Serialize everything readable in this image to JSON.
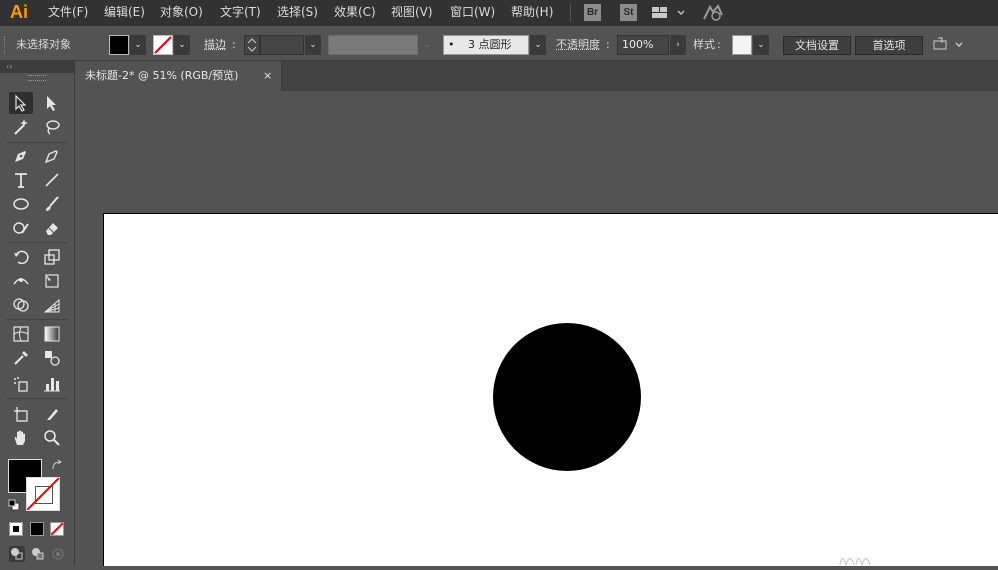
{
  "app": {
    "logo": "Ai"
  },
  "menu": [
    "文件(F)",
    "编辑(E)",
    "对象(O)",
    "文字(T)",
    "选择(S)",
    "效果(C)",
    "视图(V)",
    "窗口(W)",
    "帮助(H)"
  ],
  "menubar_icons": {
    "bridge": "Br",
    "stock": "St"
  },
  "control_bar": {
    "selection_status": "未选择对象",
    "stroke_label": "描边",
    "stroke_colon": ":",
    "brush_value": "3 点圆形",
    "brush_dot": "•",
    "opacity_label": "不透明度",
    "opacity_colon": ":",
    "opacity_value": "100%",
    "style_label": "样式",
    "style_colon": ":",
    "doc_setup": "文档设置",
    "preferences": "首选项",
    "dropdown_glyph": "⌄",
    "arrow_glyph": "›"
  },
  "tools_panel": {
    "collapse_glyph": "‹‹"
  },
  "document_tab": {
    "title": "未标题-2* @ 51% (RGB/预览)",
    "close": "×"
  },
  "colors": {
    "fill": "#000000",
    "stroke": "none",
    "accent": "#ff9a00",
    "artboard": "#ffffff"
  }
}
